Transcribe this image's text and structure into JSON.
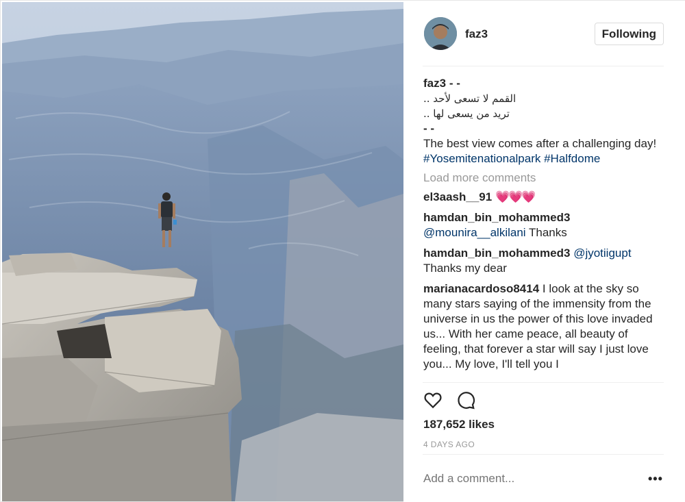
{
  "post": {
    "username": "faz3",
    "follow_label": "Following",
    "caption": {
      "username": "faz3",
      "dashes": "- -",
      "arabic_line1": "القمم لا تسعى لأحد ..",
      "arabic_line2": "تريد من يسعى لها ..",
      "dash_line": "- -",
      "text": "The best view comes after a challenging day!",
      "hashtags": "#Yosemitenationalpark #Halfdome"
    },
    "load_more_label": "Load more comments",
    "comments": [
      {
        "user": "el3aash__91",
        "mention": "",
        "text": "💗💗💗"
      },
      {
        "user": "hamdan_bin_mohammed3",
        "mention": "@mounira__alkilani",
        "text": "Thanks"
      },
      {
        "user": "hamdan_bin_mohammed3",
        "mention": "@jyotiigupt",
        "text": "Thanks my dear"
      },
      {
        "user": "marianacardoso8414",
        "mention": "",
        "text": "I look at the sky so many stars saying of the immensity from the universe in us the power of this love invaded us... With her came peace, all beauty of feeling, that forever a star will say I just love you... My love, I'll tell you I"
      }
    ],
    "likes": "187,652 likes",
    "time_ago": "4 DAYS AGO",
    "add_comment_placeholder": "Add a comment...",
    "more_label": "•••",
    "icons": {
      "like": "heart-icon",
      "comment": "comment-bubble-icon"
    }
  }
}
